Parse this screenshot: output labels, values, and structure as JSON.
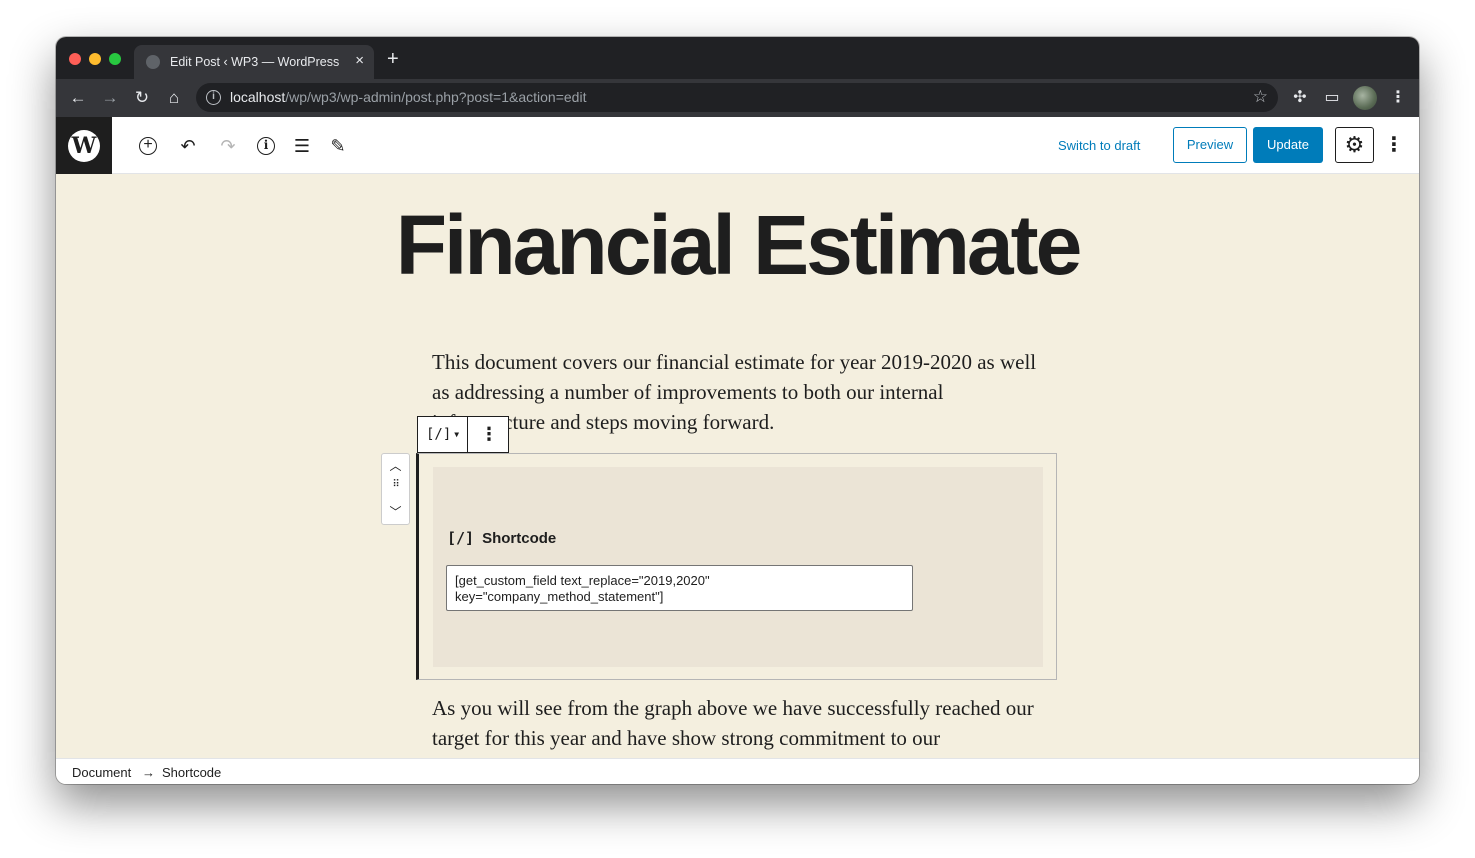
{
  "browser": {
    "tab_title": "Edit Post ‹ WP3 — WordPress",
    "tab_close": "×",
    "new_tab": "+",
    "url_host": "localhost",
    "url_path": "/wp/wp3/wp-admin/post.php?post=1&action=edit"
  },
  "editor_header": {
    "switch_to_draft": "Switch to draft",
    "preview": "Preview",
    "update": "Update"
  },
  "post": {
    "title": "Financial Estimate",
    "paragraph1": "This document covers our financial estimate for year 2019-2020 as well as addressing a number of improvements to both our internal infrastructure and steps moving forward.",
    "paragraph2": "As you will see from the graph above we have successfully reached our target for this year and have show strong commitment to our"
  },
  "shortcode_block": {
    "toolbar_icon": "[/]",
    "icon": "[/]",
    "label": "Shortcode",
    "value": "[get_custom_field text_replace=\"2019,2020\"\nkey=\"company_method_statement\"]"
  },
  "breadcrumb": {
    "root": "Document",
    "separator": "→",
    "current": "Shortcode"
  }
}
